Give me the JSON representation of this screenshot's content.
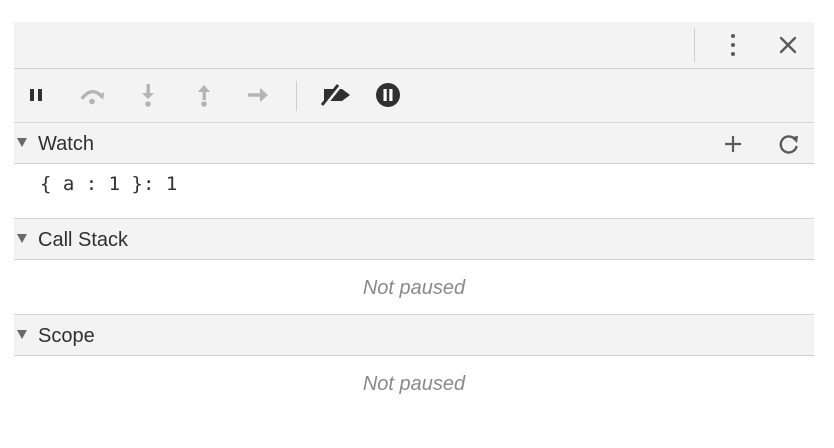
{
  "icons": {
    "more": "more-vertical-icon",
    "close": "close-icon",
    "pause": "pause-icon",
    "step_over": "step-over-icon",
    "step_into": "step-into-icon",
    "step_out": "step-out-icon",
    "step": "step-icon",
    "deactivate_breakpoints": "deactivate-breakpoints-icon",
    "pause_on_exceptions": "pause-on-exceptions-icon",
    "add": "add-icon",
    "refresh": "refresh-icon"
  },
  "colors": {
    "panel_bg": "#f3f3f3",
    "border": "#cfcfcf",
    "icon_active": "#303030",
    "icon_disabled": "#b4b4b4",
    "muted_text": "#8a8a8a"
  },
  "sections": {
    "watch": {
      "title": "Watch",
      "expression": "{ a : 1 }: 1"
    },
    "call_stack": {
      "title": "Call Stack",
      "status": "Not paused"
    },
    "scope": {
      "title": "Scope",
      "status": "Not paused"
    }
  }
}
